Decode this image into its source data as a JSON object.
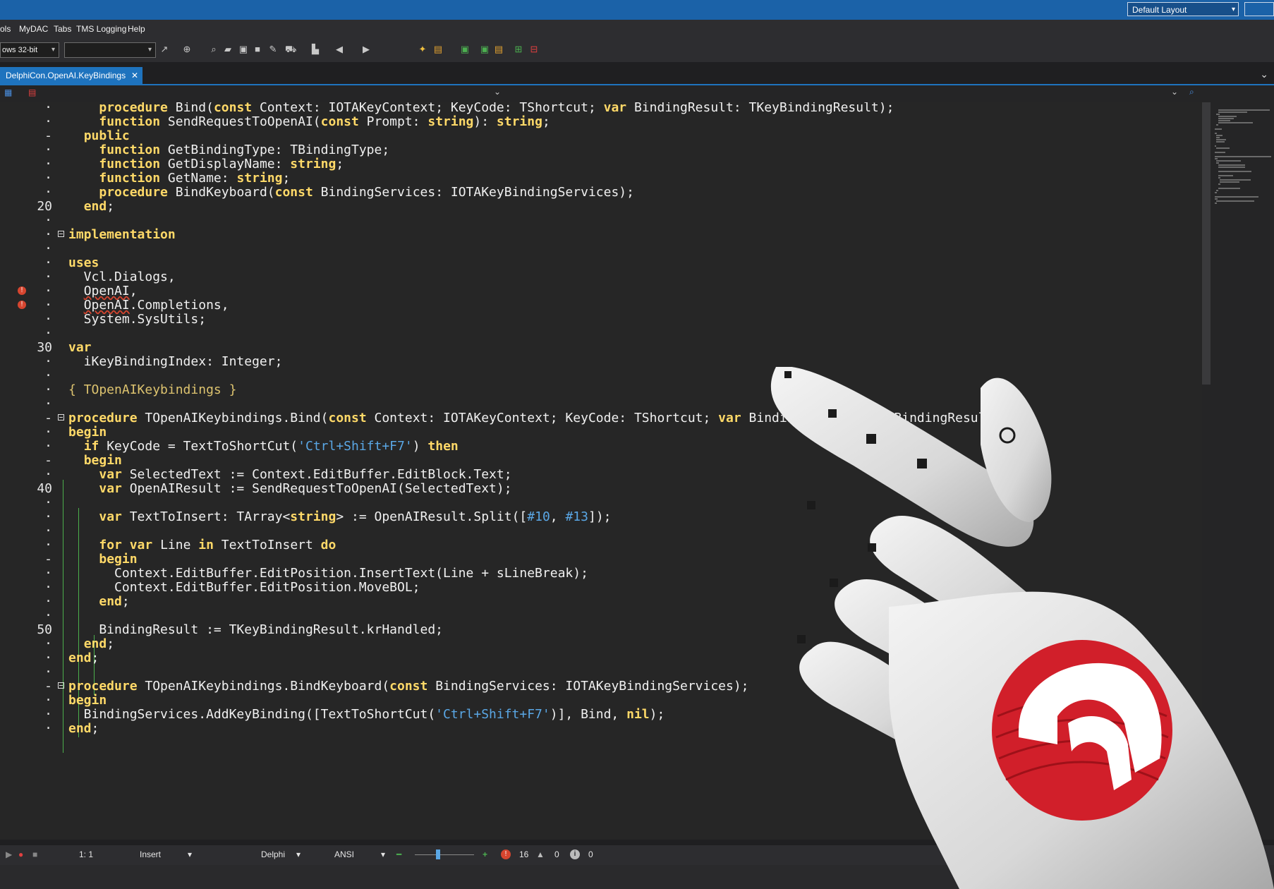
{
  "title_bar": {
    "layout_select": "Default Layout"
  },
  "menu": [
    "ols",
    "MyDAC",
    "Tabs",
    "TMS Logging",
    "Help"
  ],
  "toolbar": {
    "platform": "ows 32-bit",
    "config": ""
  },
  "tab": {
    "label": "DelphiCon.OpenAI.KeyBindings"
  },
  "editor": {
    "lines": [
      {
        "num": "·",
        "text": "    procedure Bind(const Context: IOTAKeyContext; KeyCode: TShortcut; var BindingResult: TKeyBindingResult);"
      },
      {
        "num": "·",
        "text": "    function SendRequestToOpenAI(const Prompt: string): string;"
      },
      {
        "num": "-",
        "text": "  public"
      },
      {
        "num": "·",
        "text": "    function GetBindingType: TBindingType;"
      },
      {
        "num": "·",
        "text": "    function GetDisplayName: string;"
      },
      {
        "num": "·",
        "text": "    function GetName: string;"
      },
      {
        "num": "·",
        "text": "    procedure BindKeyboard(const BindingServices: IOTAKeyBindingServices);"
      },
      {
        "num": "20",
        "text": "  end;"
      },
      {
        "num": "·",
        "text": ""
      },
      {
        "num": "·",
        "text": "implementation"
      },
      {
        "num": "·",
        "text": ""
      },
      {
        "num": "·",
        "text": "uses"
      },
      {
        "num": "·",
        "text": "  Vcl.Dialogs,"
      },
      {
        "num": "·",
        "text": "  OpenAI,"
      },
      {
        "num": "·",
        "text": "  OpenAI.Completions,"
      },
      {
        "num": "·",
        "text": "  System.SysUtils;"
      },
      {
        "num": "·",
        "text": ""
      },
      {
        "num": "30",
        "text": "var"
      },
      {
        "num": "·",
        "text": "  iKeyBindingIndex: Integer;"
      },
      {
        "num": "·",
        "text": ""
      },
      {
        "num": "·",
        "text": "{ TOpenAIKeybindings }"
      },
      {
        "num": "·",
        "text": ""
      },
      {
        "num": "-",
        "text": "procedure TOpenAIKeybindings.Bind(const Context: IOTAKeyContext; KeyCode: TShortcut; var BindingResult: TKeyBindingResult);"
      },
      {
        "num": "·",
        "text": "begin"
      },
      {
        "num": "·",
        "text": "  if KeyCode = TextToShortCut('Ctrl+Shift+F7') then"
      },
      {
        "num": "-",
        "text": "  begin"
      },
      {
        "num": "·",
        "text": "    var SelectedText := Context.EditBuffer.EditBlock.Text;"
      },
      {
        "num": "40",
        "text": "    var OpenAIResult := SendRequestToOpenAI(SelectedText);"
      },
      {
        "num": "·",
        "text": ""
      },
      {
        "num": "·",
        "text": "    var TextToInsert: TArray<string> := OpenAIResult.Split([#10, #13]);"
      },
      {
        "num": "·",
        "text": ""
      },
      {
        "num": "·",
        "text": "    for var Line in TextToInsert do"
      },
      {
        "num": "-",
        "text": "    begin"
      },
      {
        "num": "·",
        "text": "      Context.EditBuffer.EditPosition.InsertText(Line + sLineBreak);"
      },
      {
        "num": "·",
        "text": "      Context.EditBuffer.EditPosition.MoveBOL;"
      },
      {
        "num": "·",
        "text": "    end;"
      },
      {
        "num": "·",
        "text": ""
      },
      {
        "num": "50",
        "text": "    BindingResult := TKeyBindingResult.krHandled;"
      },
      {
        "num": "·",
        "text": "  end;"
      },
      {
        "num": "·",
        "text": "end;"
      },
      {
        "num": "·",
        "text": ""
      },
      {
        "num": "-",
        "text": "procedure TOpenAIKeybindings.BindKeyboard(const BindingServices: IOTAKeyBindingServices);"
      },
      {
        "num": "·",
        "text": "begin"
      },
      {
        "num": "·",
        "text": "  BindingServices.AddKeyBinding([TextToShortCut('Ctrl+Shift+F7')], Bind, nil);"
      },
      {
        "num": "·",
        "text": "end;"
      }
    ]
  },
  "status": {
    "position": "1:  1",
    "mode": "Insert",
    "language": "Delphi",
    "encoding": "ANSI",
    "errors": "16",
    "warnings": "0",
    "hints": "0"
  },
  "colors": {
    "accent": "#1e73be",
    "keyword": "#ffd968",
    "string": "#5aa7e5",
    "error": "#d6452f",
    "badge": "#d11f2a"
  },
  "icons": [
    "search-icon",
    "cursor-icon",
    "globe-icon",
    "cart-icon",
    "back-arrow-icon",
    "forward-arrow-icon",
    "save-icon",
    "open-folder-icon",
    "error-icon",
    "warning-icon",
    "info-icon",
    "run-icon",
    "helmet-logo-icon"
  ]
}
